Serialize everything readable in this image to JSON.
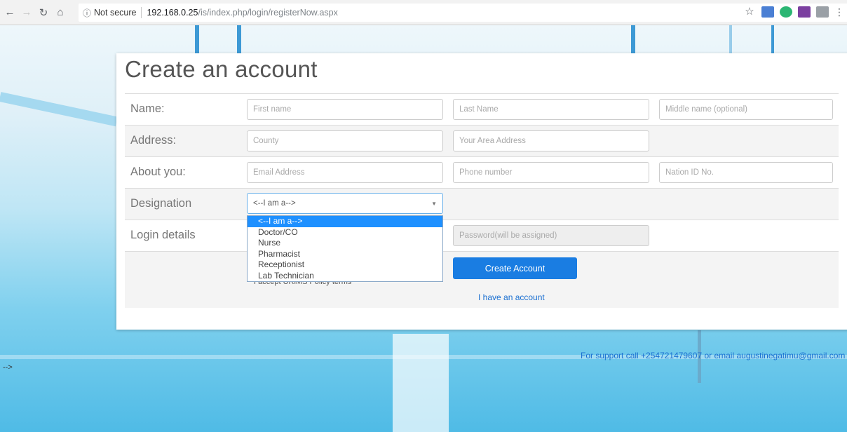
{
  "browser": {
    "security_label": "Not secure",
    "url_host": "192.168.0.25",
    "url_path": "/is/index.php/login/registerNow.aspx"
  },
  "form": {
    "title": "Create an account",
    "rows": {
      "name": {
        "label": "Name:",
        "first_placeholder": "First name",
        "last_placeholder": "Last Name",
        "middle_placeholder": "Middle name (optional)"
      },
      "address": {
        "label": "Address:",
        "county_placeholder": "County",
        "area_placeholder": "Your Area Address"
      },
      "about": {
        "label": "About you:",
        "email_placeholder": "Email Address",
        "phone_placeholder": "Phone number",
        "nid_placeholder": "Nation ID No."
      },
      "designation": {
        "label": "Designation",
        "selected": "<--I am a-->"
      },
      "login": {
        "label": "Login details",
        "password_placeholder": "Password(will be assigned)"
      }
    },
    "create_button": "Create Account",
    "have_account_link": "I have an account",
    "terms_text": "I accept URiMS Policy terms"
  },
  "designation_options": [
    {
      "label": "<--I am a-->",
      "active": true
    },
    {
      "label": "Doctor/CO",
      "active": false
    },
    {
      "label": "Nurse",
      "active": false
    },
    {
      "label": "Pharmacist",
      "active": false
    },
    {
      "label": "Receptionist",
      "active": false
    },
    {
      "label": "Lab Technician",
      "active": false
    }
  ],
  "footer": {
    "support_text": "For support call +254721479607 or email augustinegatimu@gmail.com",
    "stray_text": "-->"
  },
  "colors": {
    "primary": "#1a7de2",
    "link": "#1a6fd1",
    "highlight": "#1e90ff"
  }
}
